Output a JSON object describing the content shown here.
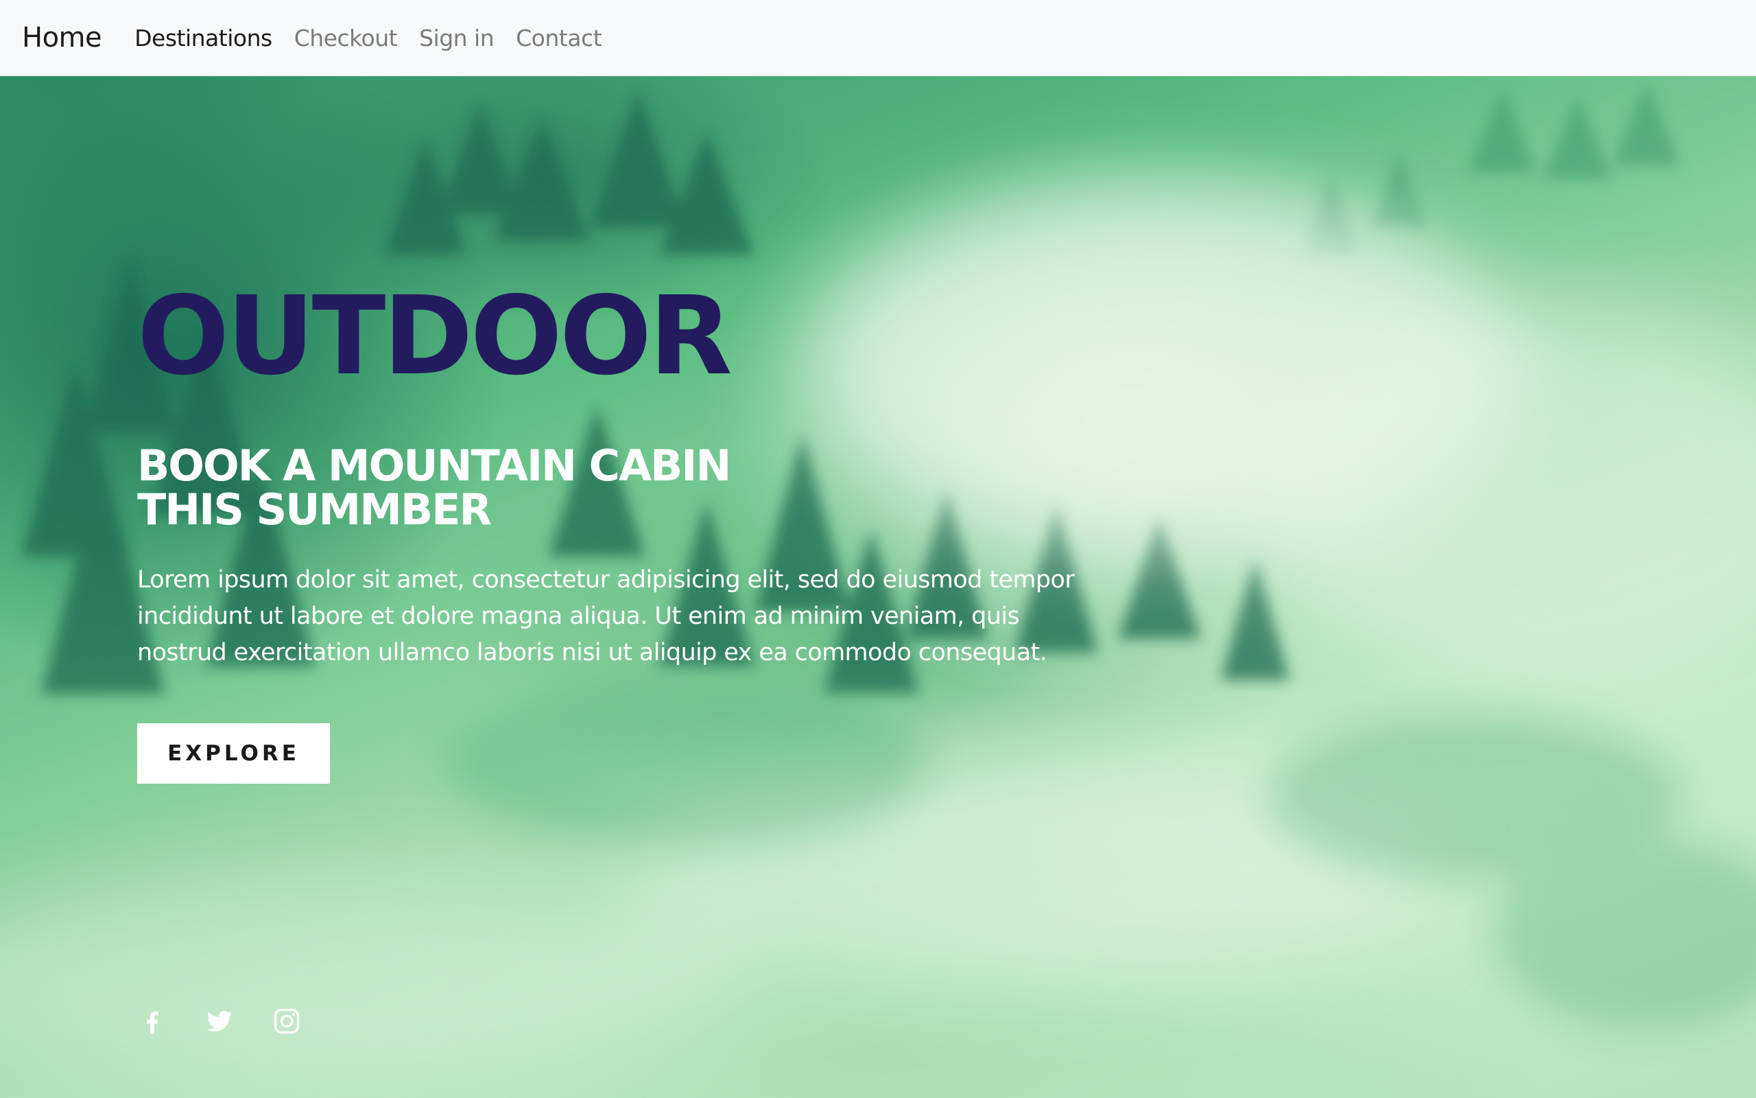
{
  "navbar": {
    "brand": "Home",
    "links": [
      {
        "label": "Destinations",
        "active": true
      },
      {
        "label": "Checkout",
        "active": false
      },
      {
        "label": "Sign in",
        "active": false
      },
      {
        "label": "Contact",
        "active": false
      }
    ]
  },
  "hero": {
    "title": "OUTDOOR",
    "subtitle_line1": "BOOK A MOUNTAIN CABIN",
    "subtitle_line2": "THIS SUMMBER",
    "description": "Lorem ipsum dolor sit amet, consectetur adipisicing elit, sed do eiusmod tempor incididunt ut labore et dolore magna aliqua. Ut enim ad minim veniam, quis nostrud exercitation ullamco laboris nisi ut aliquip ex ea commodo consequat.",
    "button_label": "EXPLORE"
  },
  "social": {
    "icons": [
      "facebook-icon",
      "twitter-icon",
      "instagram-icon"
    ]
  },
  "colors": {
    "navbar_bg": "#f8f9fb",
    "title_color": "#221c5e",
    "text_color": "#ffffff",
    "button_bg": "#ffffff"
  }
}
